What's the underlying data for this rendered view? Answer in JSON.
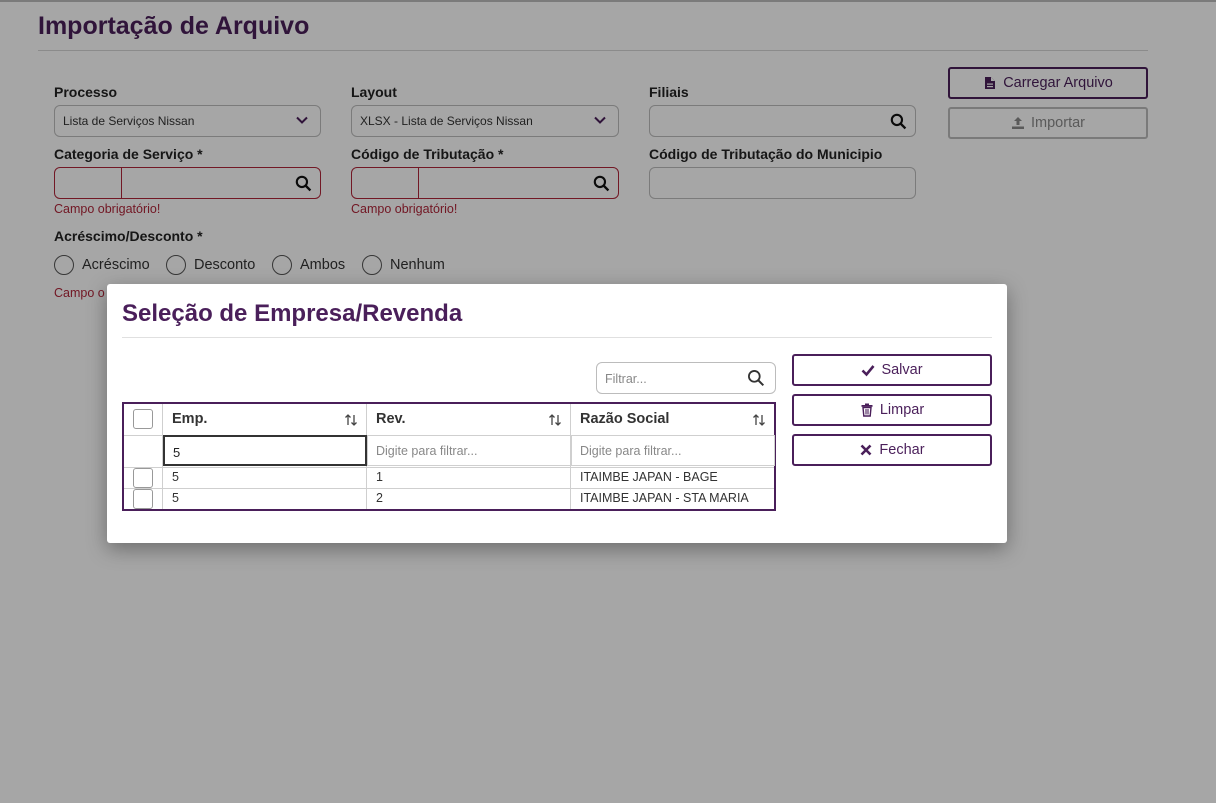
{
  "page": {
    "title": "Importação de Arquivo"
  },
  "form": {
    "processo": {
      "label": "Processo",
      "value": "Lista de Serviços Nissan"
    },
    "layout": {
      "label": "Layout",
      "value": "XLSX - Lista de Serviços Nissan"
    },
    "filiais": {
      "label": "Filiais",
      "value": ""
    },
    "categoria": {
      "label": "Categoria de Serviço *",
      "error": "Campo obrigatório!"
    },
    "codigo_trib": {
      "label": "Código de Tributação *",
      "error": "Campo obrigatório!"
    },
    "codigo_trib_mun": {
      "label": "Código de Tributação do Municipio"
    },
    "acrescimo": {
      "label": "Acréscimo/Desconto *",
      "options": [
        "Acréscimo",
        "Desconto",
        "Ambos",
        "Nenhum"
      ],
      "error": "Campo o"
    }
  },
  "buttons": {
    "carregar": "Carregar Arquivo",
    "importar": "Importar"
  },
  "modal": {
    "title": "Seleção de Empresa/Revenda",
    "filter_placeholder": "Filtrar...",
    "columns": [
      "Emp.",
      "Rev.",
      "Razão Social"
    ],
    "filter_values": {
      "emp": "5",
      "rev_placeholder": "Digite para filtrar...",
      "razao_placeholder": "Digite para filtrar..."
    },
    "rows": [
      {
        "emp": "5",
        "rev": "1",
        "razao": "ITAIMBE JAPAN - BAGE"
      },
      {
        "emp": "5",
        "rev": "2",
        "razao": "ITAIMBE JAPAN - STA MARIA"
      }
    ],
    "actions": {
      "salvar": "Salvar",
      "limpar": "Limpar",
      "fechar": "Fechar"
    }
  },
  "icons": {
    "file": "file-icon",
    "upload": "upload-icon",
    "search": "search-icon",
    "chevron": "chevron-down-icon",
    "check": "check-icon",
    "trash": "trash-icon",
    "close": "close-icon",
    "sort": "sort-icon"
  },
  "colors": {
    "accent": "#4a1f5a",
    "error": "#b0263a"
  }
}
